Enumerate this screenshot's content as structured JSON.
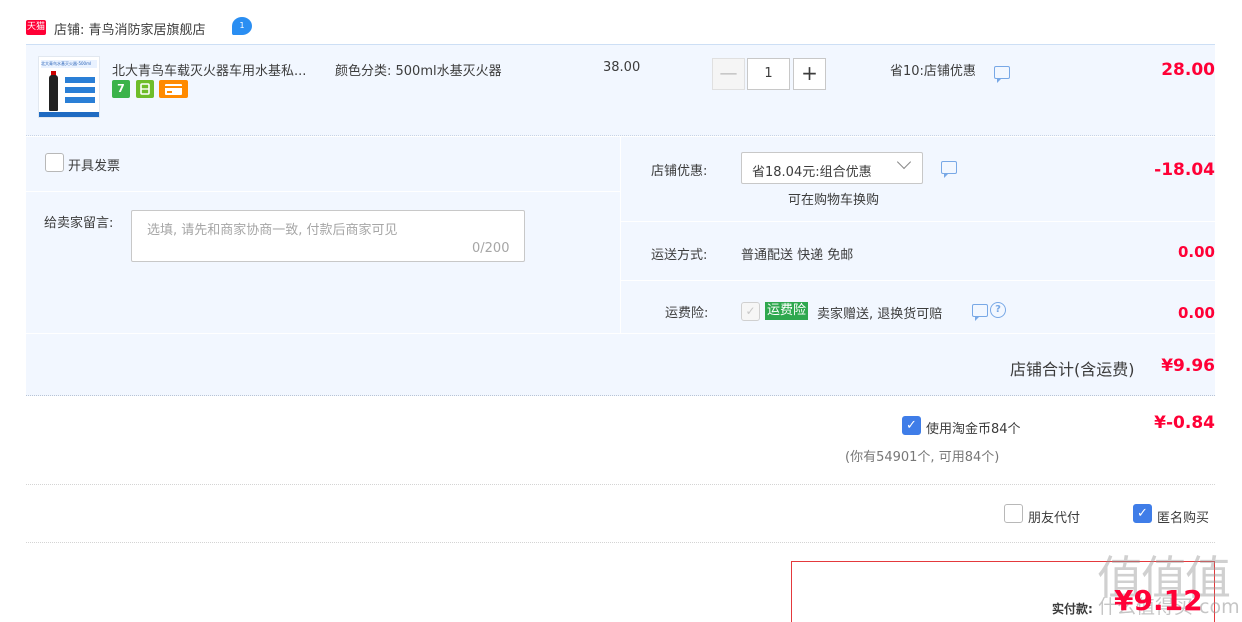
{
  "header": {
    "tmall_badge": "天猫",
    "shop_label": "店铺: 青鸟消防家居旗舰店",
    "ww_badge": "1"
  },
  "item": {
    "thumb_header": "北大青鸟水基灭火器-500ml",
    "title": "北大青鸟车载灭火器车用水基私...",
    "sku": "颜色分类: 500ml水基灭火器",
    "unit_price": "38.00",
    "services": [
      "7",
      "",
      ""
    ],
    "qty": {
      "minus": "—",
      "value": "1",
      "plus": "+"
    },
    "save_text": "省10:店铺优惠",
    "total": "28.00"
  },
  "invoice": {
    "label": "开具发票",
    "checked": false
  },
  "message": {
    "label": "给卖家留言:",
    "placeholder": "选填, 请先和商家协商一致, 付款后商家可见",
    "count": "0/200"
  },
  "shop_discount": {
    "label": "店铺优惠:",
    "selected": "省18.04元:组合优惠",
    "swap": "可在购物车换购",
    "amount": "-18.04"
  },
  "shipping": {
    "label": "运送方式:",
    "value": "普通配送 快递 免邮",
    "amount": "0.00"
  },
  "insurance": {
    "label": "运费险:",
    "tag": "运费险",
    "desc": "卖家赠送, 退换货可赔",
    "amount": "0.00",
    "help": "?"
  },
  "subtotal": {
    "label": "店铺合计(含运费)",
    "amount": "¥9.96"
  },
  "coins": {
    "label": "使用淘金币84个",
    "amount": "¥-0.84",
    "note": "(你有54901个, 可用84个)",
    "checked": true
  },
  "options": {
    "friend_pay": "朋友代付",
    "friend_checked": false,
    "anonymous": "匿名购买",
    "anonymous_checked": true
  },
  "pay": {
    "label": "实付款:",
    "amount": "¥9.12"
  },
  "watermark": {
    "big": "值值值",
    "small": "什么值得买 com"
  },
  "colors": {
    "accent_red": "#ff0036",
    "panel_bg": "#f2f7ff",
    "check_blue": "#3f7de8",
    "tag_green": "#2fa84f"
  }
}
